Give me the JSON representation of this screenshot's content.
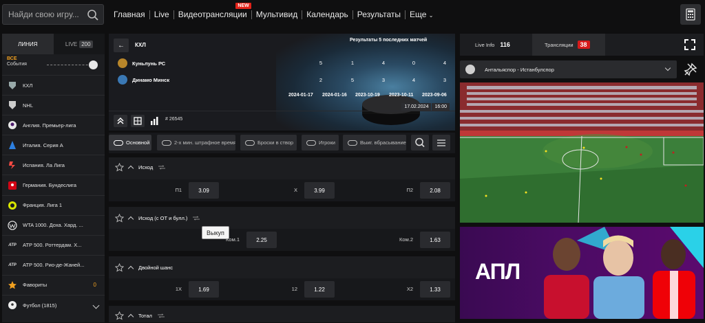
{
  "search": {
    "placeholder": "Найди свою игру..."
  },
  "nav": {
    "items": [
      "Главная",
      "Live",
      "Видеотрансляции",
      "Мультивид",
      "Календарь",
      "Результаты",
      "Еще"
    ],
    "new_badge": "NEW"
  },
  "sidebar": {
    "tab_line": "ЛИНИЯ",
    "tab_live": "LIVE",
    "live_count": "200",
    "events_all": "ВСЕ",
    "events_label": "События",
    "items": [
      {
        "label": "КХЛ",
        "icon": "khl-icon"
      },
      {
        "label": "NHL",
        "icon": "nhl-icon"
      },
      {
        "label": "Англия. Премьер-лига",
        "icon": "premier-league-icon"
      },
      {
        "label": "Италия. Серия A",
        "icon": "serie-a-icon"
      },
      {
        "label": "Испания. Ла Лига",
        "icon": "laliga-icon"
      },
      {
        "label": "Германия. Бундеслига",
        "icon": "bundesliga-icon"
      },
      {
        "label": "Франция. Лига 1",
        "icon": "ligue1-icon"
      },
      {
        "label": "WTA 1000. Доха. Хард. ...",
        "icon": "wta-icon"
      },
      {
        "label": "ATP 500. Роттердам. Х...",
        "icon": "atp-icon"
      },
      {
        "label": "ATP 500. Рио-де-Жаней...",
        "icon": "atp-icon"
      },
      {
        "label": "Фавориты",
        "icon": "star-icon",
        "count": "0"
      },
      {
        "label": "Футбол (1815)",
        "icon": "football-icon"
      }
    ]
  },
  "match": {
    "league": "КХЛ",
    "last_results_title": "Результаты 5 последних матчей",
    "teams": [
      {
        "name": "Куньлунь РС",
        "scores": [
          "5",
          "1",
          "4",
          "0",
          "4"
        ]
      },
      {
        "name": "Динамо Минск",
        "scores": [
          "2",
          "5",
          "3",
          "4",
          "3"
        ]
      }
    ],
    "dates": [
      "2024-01-17",
      "2024-01-16",
      "2023-10-19",
      "2023-10-11",
      "2023-09-06"
    ],
    "match_id": "# 26545",
    "date": "17.02.2024",
    "time": "16:00"
  },
  "filters": {
    "tabs": [
      "Основной",
      "2-х мин. штрафное время",
      "Броски в створ",
      "Игроки",
      "Выиг. вбрасывание"
    ]
  },
  "markets": [
    {
      "title": "Исход",
      "odds": [
        {
          "label": "П1",
          "value": "3.09"
        },
        {
          "label": "X",
          "value": "3.99"
        },
        {
          "label": "П2",
          "value": "2.08"
        }
      ]
    },
    {
      "title": "Исход (с ОТ и булл.)",
      "odds": [
        {
          "label": "Ком.1",
          "value": "2.25"
        },
        {
          "label": "Ком.2",
          "value": "1.63"
        }
      ]
    },
    {
      "title": "Двойной шанс",
      "odds": [
        {
          "label": "1X",
          "value": "1.69"
        },
        {
          "label": "12",
          "value": "1.22"
        },
        {
          "label": "X2",
          "value": "1.33"
        }
      ]
    },
    {
      "title": "Тотал",
      "odds": []
    }
  ],
  "tooltip": "Выкуп",
  "right": {
    "tab_liveinfo": "Live Info",
    "liveinfo_count": "116",
    "tab_streams": "Трансляции",
    "streams_count": "38",
    "stream_select": "Антальяспор - Истанбулспор",
    "promo_text": "АПЛ"
  },
  "colors": {
    "accent": "#f0a020",
    "badge_red": "#d71a1a",
    "bg": "#0f0f10",
    "panel": "#1c1d20"
  }
}
